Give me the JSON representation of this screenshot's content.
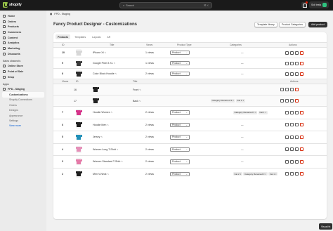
{
  "topbar": {
    "logo": "shopify",
    "search_placeholder": "Search",
    "search_kbd": "⌘ K",
    "store_name": "Sidi tests",
    "store_initials": "ST"
  },
  "sidebar": {
    "items": [
      {
        "label": "Home",
        "icon": "home-icon"
      },
      {
        "label": "Orders",
        "icon": "orders-icon"
      },
      {
        "label": "Products",
        "icon": "tag-icon"
      },
      {
        "label": "Customers",
        "icon": "person-icon"
      },
      {
        "label": "Content",
        "icon": "file-icon"
      },
      {
        "label": "Analytics",
        "icon": "chart-icon"
      },
      {
        "label": "Marketing",
        "icon": "target-icon"
      },
      {
        "label": "Discounts",
        "icon": "discount-icon"
      }
    ],
    "sales_section": "Sales channels",
    "sales_items": [
      {
        "label": "Online Store",
        "icon": "store-icon"
      },
      {
        "label": "Point of Sale",
        "icon": "pos-icon"
      },
      {
        "label": "Shop",
        "icon": "shop-icon"
      }
    ],
    "apps_section": "Apps",
    "app_name": "FPD - Staging",
    "app_subitems": [
      "Customizations",
      "Shopify Connections",
      "Orders",
      "Designs",
      "Appearance",
      "Settings"
    ],
    "view_more": "View more"
  },
  "header": {
    "breadcrumb": "FPD - Staging",
    "title": "Fancy Product Designer - Customizations",
    "template_library": "Template library",
    "product_categories": "Product Categories",
    "add_product": "Add product"
  },
  "tabs": [
    "Products",
    "Templates",
    "Layouts",
    "AR"
  ],
  "table": {
    "headers": {
      "id": "ID",
      "title": "Title",
      "views": "Views",
      "type": "Product Type",
      "categories": "Categories",
      "actions": "Actions"
    },
    "view_headers": {
      "views": "Views",
      "id": "ID",
      "title": "Title",
      "actions": "Actions"
    },
    "select_value": "Product",
    "rows": [
      {
        "id": "10",
        "title": "iPhone XI",
        "views": "1 views",
        "categories": [
          "—"
        ],
        "color": "#d7d7d7"
      },
      {
        "id": "9",
        "title": "Google Pixel 3 XL",
        "views": "1 views",
        "categories": [
          "—"
        ],
        "color": "#3a3a3a"
      },
      {
        "id": "8",
        "title": "Color Block Hoodie",
        "views": "2 views",
        "categories": [
          "—"
        ],
        "color": "#2b2b2b"
      }
    ],
    "view_rows": [
      {
        "id": "16",
        "title": "Front",
        "color": "#222222"
      },
      {
        "id": "17",
        "title": "Back",
        "color": "#222222"
      }
    ],
    "view_row_categories": [
      "Category Renamed 3",
      "Cat 1"
    ],
    "rows2": [
      {
        "id": "7",
        "title": "Hoodie Women",
        "views": "2 views",
        "categories": [
          "Category Renamed 3",
          "Cat 1"
        ],
        "color": "#d6338a"
      },
      {
        "id": "6",
        "title": "Hoodie Men",
        "views": "2 views",
        "categories": [
          "—"
        ],
        "color": "#1f1f1f"
      },
      {
        "id": "5",
        "title": "Jersey",
        "views": "2 views",
        "categories": [
          "—"
        ],
        "color": "#1f8fb8"
      },
      {
        "id": "4",
        "title": "Women Long T-Shirt",
        "views": "2 views",
        "categories": [
          "—"
        ],
        "color": "#e58fb8"
      },
      {
        "id": "3",
        "title": "Women Standard T-Shirt",
        "views": "2 views",
        "categories": [
          "—"
        ],
        "color": "#e57aa8"
      },
      {
        "id": "2",
        "title": "Men V-Neck",
        "views": "2 views",
        "categories": [
          "Cat 2",
          "Category Renamed 3",
          "Cat 1"
        ],
        "color": "#1f1f1f"
      }
    ]
  },
  "footer": {
    "visual_btn": "Visual th"
  },
  "colors": {
    "topbar": "#1a1a1a",
    "primary_button": "#303030",
    "link": "#005bd3",
    "danger": "#d72c0d"
  }
}
